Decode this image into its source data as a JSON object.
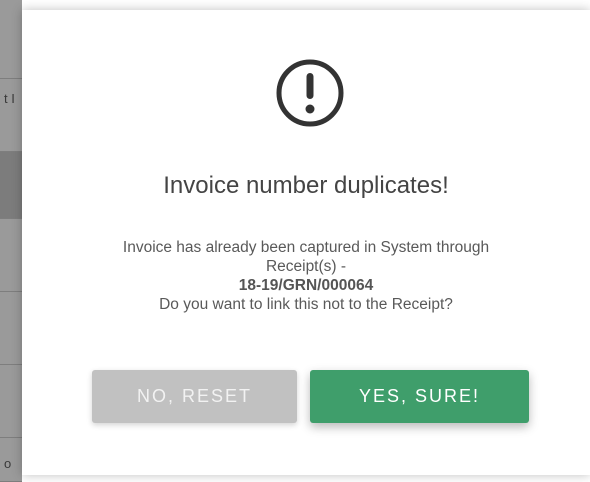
{
  "background": {
    "fragments": [
      "t I",
      "o"
    ]
  },
  "dialog": {
    "icon": "exclamation-circle-icon",
    "title": "Invoice number duplicates!",
    "message_line1": "Invoice has already been captured in System through",
    "message_line2": "Receipt(s) -",
    "receipt_ref": "18-19/GRN/000064",
    "message_line3": "Do you want to link this not to the Receipt?",
    "cancel_label": "NO, RESET",
    "confirm_label": "YES, SURE!"
  },
  "colors": {
    "confirm": "#3f9e6b",
    "cancel": "#c1c1c1",
    "title": "#444444",
    "text": "#595959"
  }
}
